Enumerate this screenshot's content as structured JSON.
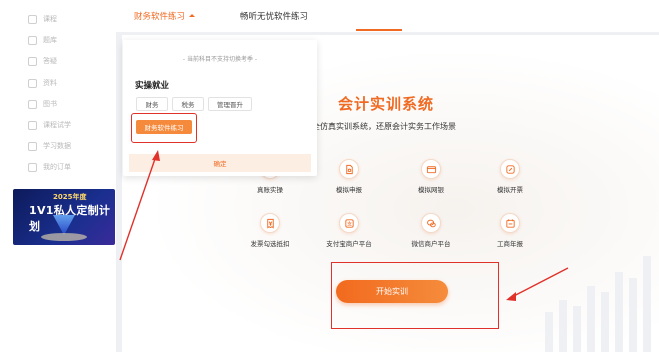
{
  "sidebar": {
    "items": [
      {
        "label": "课程",
        "icon": "screen-icon"
      },
      {
        "label": "题库",
        "icon": "document-icon"
      },
      {
        "label": "答疑",
        "icon": "question-icon"
      },
      {
        "label": "资料",
        "icon": "folder-icon"
      },
      {
        "label": "图书",
        "icon": "book-icon"
      },
      {
        "label": "课程试学",
        "icon": "clock-icon"
      },
      {
        "label": "学习数据",
        "icon": "chart-icon"
      },
      {
        "label": "我的订单",
        "icon": "order-icon"
      }
    ],
    "banner": {
      "line1": "2025年度",
      "line2": "1V1私人定制计划"
    }
  },
  "tabs": {
    "active": "财务软件练习",
    "other": "畅听无忧软件练习"
  },
  "dropdown": {
    "notice": "- 当前科目不支持切换考季 -",
    "section": "实操就业",
    "chips": [
      "财务",
      "税务",
      "管理晋升"
    ],
    "selected": "财务软件练习",
    "confirm": "确定"
  },
  "hero": {
    "title": "会计实训系统",
    "subtitle": "全仿真实训系统，还原会计实务工作场景"
  },
  "features": [
    {
      "label": "真账实操",
      "icon": "ledger-icon"
    },
    {
      "label": "模拟申报",
      "icon": "declare-icon"
    },
    {
      "label": "模拟网银",
      "icon": "bank-card-icon"
    },
    {
      "label": "模拟开票",
      "icon": "invoice-edit-icon"
    },
    {
      "label": "发票勾选抵扣",
      "icon": "yen-receipt-icon"
    },
    {
      "label": "支付宝商户平台",
      "icon": "alipay-icon"
    },
    {
      "label": "微信商户平台",
      "icon": "wechat-icon"
    },
    {
      "label": "工商年报",
      "icon": "calendar-report-icon"
    }
  ],
  "start_button": "开始实训",
  "colors": {
    "accent": "#f06a22",
    "highlight": "#e0312a"
  }
}
